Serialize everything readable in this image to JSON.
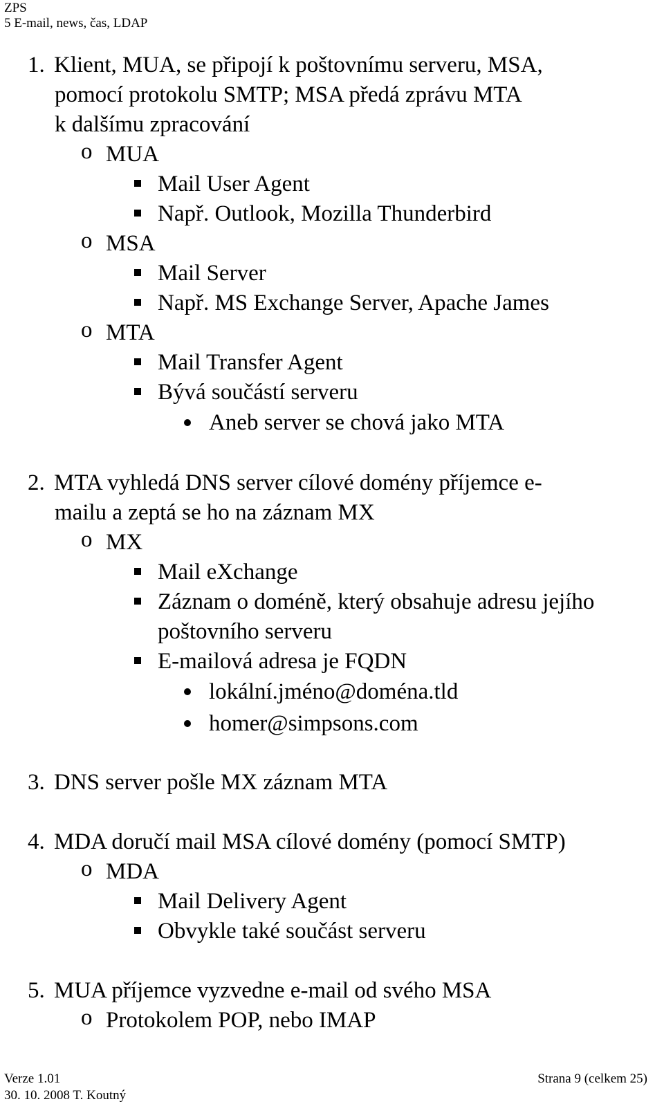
{
  "header": {
    "line1": "ZPS",
    "line2": "5 E-mail, news, čas, LDAP"
  },
  "steps": [
    {
      "number": "1.",
      "lines": [
        "Klient, MUA, se připojí k poštovnímu serveru, MSA,",
        "pomocí protokolu SMTP; MSA předá zprávu MTA",
        "k dalšímu zpracování"
      ],
      "items": [
        {
          "label": "MUA",
          "children": [
            {
              "text": "Mail  User Agent"
            },
            {
              "text": "Např. Outlook, Mozilla Thunderbird"
            }
          ]
        },
        {
          "label": "MSA",
          "children": [
            {
              "text": "Mail Server"
            },
            {
              "text": "Např. MS Exchange Server, Apache James"
            }
          ]
        },
        {
          "label": "MTA",
          "children": [
            {
              "text": "Mail Transfer Agent"
            },
            {
              "text": "Bývá součástí serveru",
              "children": [
                "Aneb server se chová jako MTA"
              ]
            }
          ]
        }
      ]
    },
    {
      "number": "2.",
      "lines": [
        "MTA vyhledá DNS server cílové domény příjemce e-",
        "mailu a zeptá se ho na záznam MX"
      ],
      "items": [
        {
          "label": "MX",
          "children": [
            {
              "text": "Mail eXchange"
            },
            {
              "lines": [
                "Záznam o doméně, který obsahuje adresu jejího",
                "poštovního serveru"
              ]
            },
            {
              "text": "E-mailová adresa je FQDN",
              "children": [
                "lokální.jméno@doména.tld",
                "homer@simpsons.com"
              ]
            }
          ]
        }
      ]
    },
    {
      "number": "3.",
      "lines": [
        "DNS server pošle MX záznam MTA"
      ]
    },
    {
      "number": "4.",
      "lines": [
        "MDA doručí mail MSA cílové domény (pomocí SMTP)"
      ],
      "items": [
        {
          "label": "MDA",
          "children": [
            {
              "text": "Mail Delivery Agent"
            },
            {
              "text": "Obvykle také součást serveru"
            }
          ]
        }
      ]
    },
    {
      "number": "5.",
      "lines": [
        "MUA příjemce vyzvedne e-mail od svého MSA"
      ],
      "items": [
        {
          "label": "Protokolem POP, nebo IMAP"
        }
      ]
    }
  ],
  "footer": {
    "version": "Verze 1.01",
    "date_author": "30. 10. 2008 T. Koutný",
    "page": "Strana 9 (celkem 25)"
  }
}
